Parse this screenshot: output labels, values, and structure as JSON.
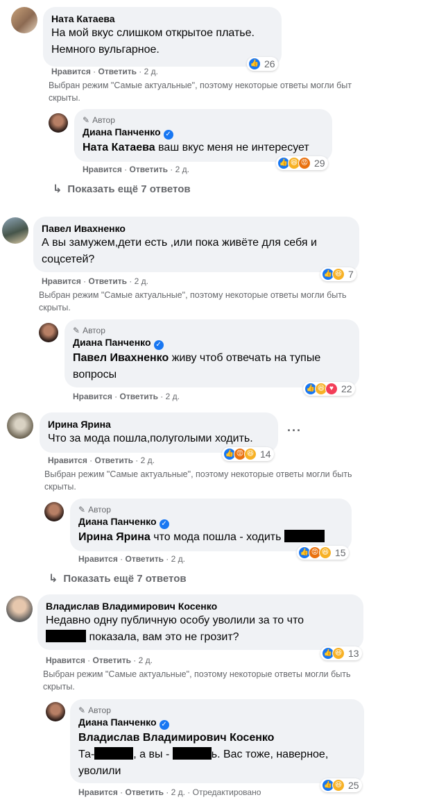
{
  "labels": {
    "like": "Нравится",
    "reply": "Ответить",
    "author": "Автор",
    "notice_a": "Выбран режим \"Самые актуальные\", поэтому некоторые ответы могли быт",
    "notice_b": "Выбран режим \"Самые актуальные\", поэтому некоторые ответы могли быть",
    "notice_tail": "скрыты.",
    "show_more": "Показать ещё 7 ответов",
    "edited": "Отредактировано"
  },
  "threads": [
    {
      "name": "Ната Катаева",
      "text1": "На мой вкус слишком открытое платье.",
      "text2": "Немного вульгарное.",
      "time": "2 д.",
      "reactions": "26",
      "reply": {
        "name": "Диана Панченко",
        "mention": "Ната Катаева",
        "text": " ваш вкус меня не интересует",
        "time": "2 д.",
        "reactions": "29"
      }
    },
    {
      "name": "Павел Ивахненко",
      "text1": "А вы замужем,дети есть ,или пока живёте для себя и",
      "text2": "соцсетей?",
      "time": "2 д.",
      "reactions": "7",
      "reply": {
        "name": "Диана Панченко",
        "mention": "Павел Ивахненко",
        "text": " живу чтоб отвечать на тупые",
        "text2": "вопросы",
        "time": "2 д.",
        "reactions": "22"
      }
    },
    {
      "name": "Ирина Ярина",
      "text1": "Что за мода пошла,полуголыми ходить.",
      "time": "2 д.",
      "reactions": "14",
      "reply": {
        "name": "Диана Панченко",
        "mention": "Ирина Ярина",
        "text": " что мода пошла - ходить",
        "time": "2 д.",
        "reactions": "15"
      }
    },
    {
      "name": "Владислав Владимирович Косенко",
      "text1": "Недавно одну публичную особу уволили за то что",
      "text2": " показала, вам это не грозит?",
      "time": "2 д.",
      "reactions": "13",
      "reply": {
        "name": "Диана Панченко",
        "mention": "Владислав Владимирович Косенко",
        "t1": "Та-",
        "t2": ", а вы - ",
        "t3": "ь. Вас тоже, наверное,",
        "t4": "уволили",
        "time": "2 д.",
        "reactions": "25"
      }
    }
  ]
}
